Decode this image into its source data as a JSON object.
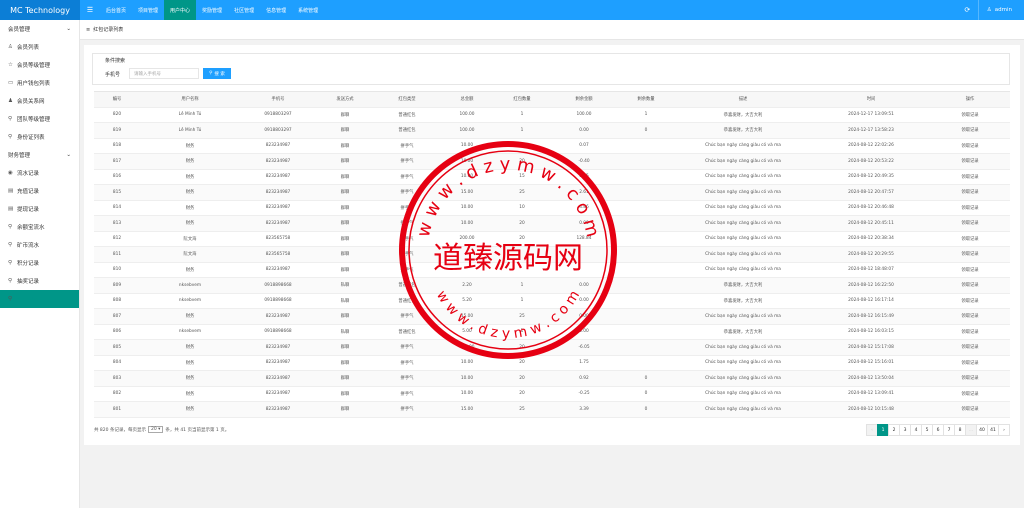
{
  "brand": "MC Technology",
  "menu_toggle": "☰",
  "topnav": [
    {
      "label": "后台首页"
    },
    {
      "label": "项目管理"
    },
    {
      "label": "用户中心"
    },
    {
      "label": "奖励管理"
    },
    {
      "label": "社区管理"
    },
    {
      "label": "信息管理"
    },
    {
      "label": "系统管理"
    }
  ],
  "user": "admin",
  "sidebar": [
    {
      "type": "group",
      "label": "会员管理",
      "icon": "chevron-down-icon"
    },
    {
      "type": "item",
      "label": "会员列表",
      "icon": "user-icon",
      "glyph": "♙"
    },
    {
      "type": "item",
      "label": "会员等级管理",
      "icon": "star-icon",
      "glyph": "☆"
    },
    {
      "type": "item",
      "label": "用户钱包列表",
      "icon": "wallet-icon",
      "glyph": "▭"
    },
    {
      "type": "item",
      "label": "会员关系网",
      "icon": "users-icon",
      "glyph": "♟"
    },
    {
      "type": "item",
      "label": "团队等级管理",
      "icon": "link-icon",
      "glyph": "⚲"
    },
    {
      "type": "item",
      "label": "身份证列表",
      "icon": "link-icon",
      "glyph": "⚲"
    },
    {
      "type": "group",
      "label": "财务管理",
      "icon": "chevron-down-icon"
    },
    {
      "type": "item",
      "label": "流水记录",
      "icon": "circle-icon",
      "glyph": "◉"
    },
    {
      "type": "item",
      "label": "充值记录",
      "icon": "doc-icon",
      "glyph": "▤"
    },
    {
      "type": "item",
      "label": "提现记录",
      "icon": "doc-icon",
      "glyph": "▤"
    },
    {
      "type": "item",
      "label": "余额宝流水",
      "icon": "link-icon",
      "glyph": "⚲"
    },
    {
      "type": "item",
      "label": "矿币流水",
      "icon": "link-icon",
      "glyph": "⚲"
    },
    {
      "type": "item",
      "label": "积分记录",
      "icon": "link-icon",
      "glyph": "⚲"
    },
    {
      "type": "item",
      "label": "抽奖记录",
      "icon": "link-icon",
      "glyph": "⚲"
    },
    {
      "type": "item",
      "label": "红包记录",
      "icon": "link-icon",
      "glyph": "⚲",
      "active": true
    }
  ],
  "breadcrumb": "红包记录列表",
  "filter": {
    "title": "条件搜索",
    "phone_label": "手机号",
    "phone_placeholder": "请输入手机号",
    "search_label": "搜 索"
  },
  "table": {
    "headers": [
      "编号",
      "用户名称",
      "手机号",
      "发送方式",
      "红包类型",
      "总金额",
      "红包数量",
      "剩余金额",
      "剩余数量",
      "描述",
      "时间",
      "操作"
    ],
    "rows": [
      [
        "820",
        "Lê Minh Tú",
        "0918803297",
        "群聊",
        "普通红包",
        "100.00",
        "1",
        "100.00",
        "1",
        "恭喜发财，大吉大利",
        "2024-12-17 13:09:51",
        "领取记录"
      ],
      [
        "819",
        "Lê Minh Tú",
        "0918803297",
        "群聊",
        "普通红包",
        "100.00",
        "1",
        "0.00",
        "0",
        "恭喜发财，大吉大利",
        "2024-12-17 13:58:23",
        "领取记录"
      ],
      [
        "818",
        "财务",
        "823234987",
        "群聊",
        "拼手气",
        "10.00",
        "20",
        "0.07",
        "",
        "Chúc bạn ngày càng giàu có và ma",
        "2024-08-12 22:02:26",
        "领取记录"
      ],
      [
        "817",
        "财务",
        "823234987",
        "群聊",
        "拼手气",
        "10.00",
        "20",
        "-0.40",
        "",
        "Chúc bạn ngày càng giàu có và ma",
        "2024-08-12 20:53:22",
        "领取记录"
      ],
      [
        "816",
        "财务",
        "823234987",
        "群聊",
        "拼手气",
        "10.00",
        "15",
        "0.15",
        "",
        "Chúc bạn ngày càng giàu có và ma",
        "2024-08-12 20:49:35",
        "领取记录"
      ],
      [
        "815",
        "财务",
        "823234987",
        "群聊",
        "拼手气",
        "15.00",
        "25",
        "2.61",
        "",
        "Chúc bạn ngày càng giàu có và ma",
        "2024-08-12 20:47:57",
        "领取记录"
      ],
      [
        "814",
        "财务",
        "823234987",
        "群聊",
        "拼手气",
        "10.00",
        "10",
        "4.86",
        "",
        "Chúc bạn ngày càng giàu có và ma",
        "2024-08-12 20:46:48",
        "领取记录"
      ],
      [
        "813",
        "财务",
        "823234987",
        "群聊",
        "拼手气",
        "10.00",
        "20",
        "0.00",
        "",
        "Chúc bạn ngày càng giàu có và ma",
        "2024-08-12 20:45:11",
        "领取记录"
      ],
      [
        "812",
        "阮文海",
        "823565758",
        "群聊",
        "拼手气",
        "200.00",
        "20",
        "128.84",
        "",
        "Chúc bạn ngày càng giàu có và ma",
        "2024-08-12 20:38:34",
        "领取记录"
      ],
      [
        "811",
        "阮文海",
        "823565758",
        "群聊",
        "拼手气",
        "",
        "",
        "",
        "",
        "Chúc bạn ngày càng giàu có và ma",
        "2024-08-12 20:29:55",
        "领取记录"
      ],
      [
        "810",
        "财务",
        "823234987",
        "群聊",
        "拼手气",
        "",
        "",
        "",
        "",
        "Chúc bạn ngày càng giàu có và ma",
        "2024-08-12 18:48:07",
        "领取记录"
      ],
      [
        "809",
        "nksebvem",
        "0918898668",
        "私聊",
        "普通红包",
        "2.20",
        "1",
        "0.00",
        "",
        "恭喜发财，大吉大利",
        "2024-08-12 16:22:50",
        "领取记录"
      ],
      [
        "808",
        "nksebvem",
        "0918898668",
        "私聊",
        "普通红包",
        "5.20",
        "1",
        "0.00",
        "",
        "恭喜发财，大吉大利",
        "2024-08-12 16:17:14",
        "领取记录"
      ],
      [
        "807",
        "财务",
        "823234987",
        "群聊",
        "拼手气",
        "15.00",
        "25",
        "0.00",
        "",
        "Chúc bạn ngày càng giàu có và ma",
        "2024-08-12 16:15:49",
        "领取记录"
      ],
      [
        "806",
        "nksebvem",
        "0918898668",
        "私聊",
        "普通红包",
        "5.00",
        "1",
        "0.00",
        "",
        "恭喜发财，大吉大利",
        "2024-08-12 16:03:15",
        "领取记录"
      ],
      [
        "805",
        "财务",
        "823234987",
        "群聊",
        "拼手气",
        "200.00",
        "20",
        "-6.05",
        "",
        "Chúc bạn ngày càng giàu có và ma",
        "2024-08-12 15:17:08",
        "领取记录"
      ],
      [
        "804",
        "财务",
        "823234987",
        "群聊",
        "拼手气",
        "10.00",
        "20",
        "1.75",
        "",
        "Chúc bạn ngày càng giàu có và ma",
        "2024-08-12 15:16:01",
        "领取记录"
      ],
      [
        "803",
        "财务",
        "823234987",
        "群聊",
        "拼手气",
        "10.00",
        "20",
        "0.92",
        "0",
        "Chúc bạn ngày càng giàu có và ma",
        "2024-08-12 13:50:04",
        "领取记录"
      ],
      [
        "802",
        "财务",
        "823234987",
        "群聊",
        "拼手气",
        "10.00",
        "20",
        "-0.25",
        "0",
        "Chúc bạn ngày càng giàu có và ma",
        "2024-08-12 13:09:41",
        "领取记录"
      ],
      [
        "801",
        "财务",
        "823234987",
        "群聊",
        "拼手气",
        "15.00",
        "25",
        "3.39",
        "0",
        "Chúc bạn ngày càng giàu có và ma",
        "2024-08-12 10:15:48",
        "领取记录"
      ]
    ]
  },
  "pager": {
    "info_prefix": "共 820 条记录，每页显示",
    "page_size": "20",
    "info_suffix": "条，共 41 页当前显示第 1 页。",
    "pages": [
      "‹",
      "1",
      "2",
      "3",
      "4",
      "5",
      "6",
      "7",
      "8",
      "...",
      "40",
      "41",
      "›"
    ]
  },
  "watermark": {
    "text": "道臻源码网",
    "ring_top": "w w w . d z y m w . c o m",
    "ring_bottom": "w w w . d z y m w . c o m",
    "color": "#e60012"
  }
}
